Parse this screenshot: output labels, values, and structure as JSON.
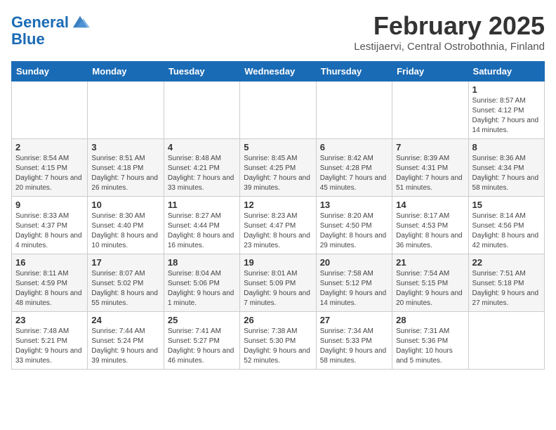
{
  "header": {
    "logo_line1": "General",
    "logo_line2": "Blue",
    "title": "February 2025",
    "subtitle": "Lestijaervi, Central Ostrobothnia, Finland"
  },
  "days_of_week": [
    "Sunday",
    "Monday",
    "Tuesday",
    "Wednesday",
    "Thursday",
    "Friday",
    "Saturday"
  ],
  "weeks": [
    {
      "days": [
        {
          "num": "",
          "info": ""
        },
        {
          "num": "",
          "info": ""
        },
        {
          "num": "",
          "info": ""
        },
        {
          "num": "",
          "info": ""
        },
        {
          "num": "",
          "info": ""
        },
        {
          "num": "",
          "info": ""
        },
        {
          "num": "1",
          "info": "Sunrise: 8:57 AM\nSunset: 4:12 PM\nDaylight: 7 hours and 14 minutes."
        }
      ]
    },
    {
      "days": [
        {
          "num": "2",
          "info": "Sunrise: 8:54 AM\nSunset: 4:15 PM\nDaylight: 7 hours and 20 minutes."
        },
        {
          "num": "3",
          "info": "Sunrise: 8:51 AM\nSunset: 4:18 PM\nDaylight: 7 hours and 26 minutes."
        },
        {
          "num": "4",
          "info": "Sunrise: 8:48 AM\nSunset: 4:21 PM\nDaylight: 7 hours and 33 minutes."
        },
        {
          "num": "5",
          "info": "Sunrise: 8:45 AM\nSunset: 4:25 PM\nDaylight: 7 hours and 39 minutes."
        },
        {
          "num": "6",
          "info": "Sunrise: 8:42 AM\nSunset: 4:28 PM\nDaylight: 7 hours and 45 minutes."
        },
        {
          "num": "7",
          "info": "Sunrise: 8:39 AM\nSunset: 4:31 PM\nDaylight: 7 hours and 51 minutes."
        },
        {
          "num": "8",
          "info": "Sunrise: 8:36 AM\nSunset: 4:34 PM\nDaylight: 7 hours and 58 minutes."
        }
      ]
    },
    {
      "days": [
        {
          "num": "9",
          "info": "Sunrise: 8:33 AM\nSunset: 4:37 PM\nDaylight: 8 hours and 4 minutes."
        },
        {
          "num": "10",
          "info": "Sunrise: 8:30 AM\nSunset: 4:40 PM\nDaylight: 8 hours and 10 minutes."
        },
        {
          "num": "11",
          "info": "Sunrise: 8:27 AM\nSunset: 4:44 PM\nDaylight: 8 hours and 16 minutes."
        },
        {
          "num": "12",
          "info": "Sunrise: 8:23 AM\nSunset: 4:47 PM\nDaylight: 8 hours and 23 minutes."
        },
        {
          "num": "13",
          "info": "Sunrise: 8:20 AM\nSunset: 4:50 PM\nDaylight: 8 hours and 29 minutes."
        },
        {
          "num": "14",
          "info": "Sunrise: 8:17 AM\nSunset: 4:53 PM\nDaylight: 8 hours and 36 minutes."
        },
        {
          "num": "15",
          "info": "Sunrise: 8:14 AM\nSunset: 4:56 PM\nDaylight: 8 hours and 42 minutes."
        }
      ]
    },
    {
      "days": [
        {
          "num": "16",
          "info": "Sunrise: 8:11 AM\nSunset: 4:59 PM\nDaylight: 8 hours and 48 minutes."
        },
        {
          "num": "17",
          "info": "Sunrise: 8:07 AM\nSunset: 5:02 PM\nDaylight: 8 hours and 55 minutes."
        },
        {
          "num": "18",
          "info": "Sunrise: 8:04 AM\nSunset: 5:06 PM\nDaylight: 9 hours and 1 minute."
        },
        {
          "num": "19",
          "info": "Sunrise: 8:01 AM\nSunset: 5:09 PM\nDaylight: 9 hours and 7 minutes."
        },
        {
          "num": "20",
          "info": "Sunrise: 7:58 AM\nSunset: 5:12 PM\nDaylight: 9 hours and 14 minutes."
        },
        {
          "num": "21",
          "info": "Sunrise: 7:54 AM\nSunset: 5:15 PM\nDaylight: 9 hours and 20 minutes."
        },
        {
          "num": "22",
          "info": "Sunrise: 7:51 AM\nSunset: 5:18 PM\nDaylight: 9 hours and 27 minutes."
        }
      ]
    },
    {
      "days": [
        {
          "num": "23",
          "info": "Sunrise: 7:48 AM\nSunset: 5:21 PM\nDaylight: 9 hours and 33 minutes."
        },
        {
          "num": "24",
          "info": "Sunrise: 7:44 AM\nSunset: 5:24 PM\nDaylight: 9 hours and 39 minutes."
        },
        {
          "num": "25",
          "info": "Sunrise: 7:41 AM\nSunset: 5:27 PM\nDaylight: 9 hours and 46 minutes."
        },
        {
          "num": "26",
          "info": "Sunrise: 7:38 AM\nSunset: 5:30 PM\nDaylight: 9 hours and 52 minutes."
        },
        {
          "num": "27",
          "info": "Sunrise: 7:34 AM\nSunset: 5:33 PM\nDaylight: 9 hours and 58 minutes."
        },
        {
          "num": "28",
          "info": "Sunrise: 7:31 AM\nSunset: 5:36 PM\nDaylight: 10 hours and 5 minutes."
        },
        {
          "num": "",
          "info": ""
        }
      ]
    }
  ]
}
